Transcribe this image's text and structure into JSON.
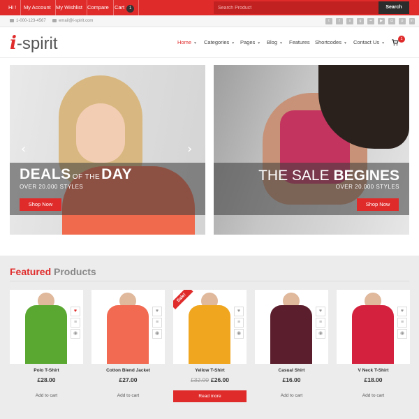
{
  "topbar": {
    "hi": "Hi !",
    "my_account": "My Account",
    "my_wishlist": "My Wishlist",
    "compare": "Compare",
    "cart": "Cart",
    "cart_count": "1",
    "search_placeholder": "Search Product",
    "search_button": "Search"
  },
  "contact": {
    "phone": "1-000-123-4567",
    "email": "email@i-spirit.com"
  },
  "social_icons": [
    "twitter-icon",
    "facebook-icon",
    "skype-icon",
    "google-plus-icon",
    "vine-icon",
    "flickr-icon",
    "vimeo-icon",
    "youtube-icon",
    "instagram-icon",
    "pinterest-icon",
    "linkedin-icon"
  ],
  "logo": {
    "mark": "i",
    "text": "-spirit"
  },
  "nav": {
    "home": "Home",
    "categories": "Categories",
    "pages": "Pages",
    "blog": "Blog",
    "features": "Features",
    "shortcodes": "Shortcodes",
    "contact_us": "Contact Us",
    "cart_badge": "1"
  },
  "banner_left": {
    "deals": "DEALS",
    "of_the": "OF THE",
    "day": "DAY",
    "styles": "OVER 20.000 STYLES",
    "button": "Shop Now"
  },
  "banner_right": {
    "the_sale": "THE SALE",
    "begines": "BEGINES",
    "styles": "OVER 20.000 STYLES",
    "button": "Shop Now"
  },
  "featured": {
    "title_red": "Featured",
    "title_gray": "Products"
  },
  "products": [
    {
      "name": "Polo T-Shirt",
      "price": "£28.00",
      "action": "Add to cart",
      "color": "#5aa832"
    },
    {
      "name": "Cotton Blend Jacket",
      "price": "£27.00",
      "action": "Add to cart",
      "color": "#f26a52"
    },
    {
      "name": "Yellow T-Shirt",
      "old_price": "£32.00",
      "price": "£26.00",
      "action": "Read more",
      "badge": "Sale!",
      "color": "#f0a61e"
    },
    {
      "name": "Casual Shirt",
      "price": "£16.00",
      "action": "Add to cart",
      "color": "#5a1e2c"
    },
    {
      "name": "V Neck T-Shirt",
      "price": "£18.00",
      "action": "Add to cart",
      "color": "#d4223e"
    }
  ],
  "colors": {
    "accent": "#e02b2b",
    "dark": "#2c2c2c"
  }
}
